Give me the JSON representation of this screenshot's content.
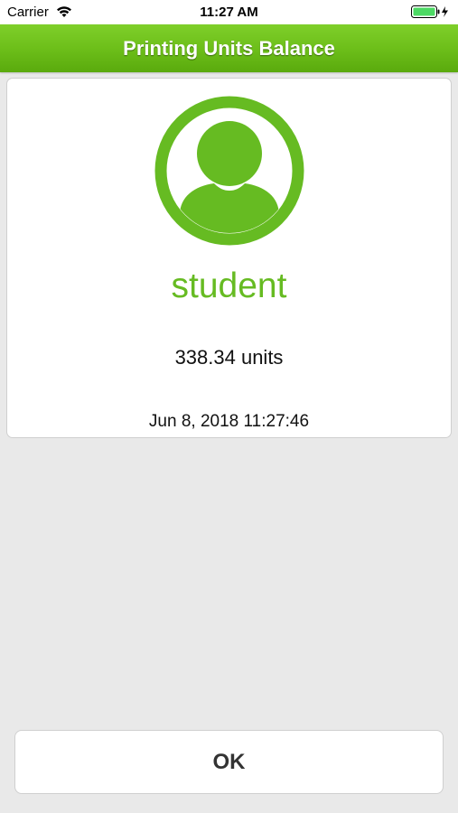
{
  "status_bar": {
    "carrier": "Carrier",
    "time": "11:27 AM",
    "wifi_icon": "wifi-icon",
    "battery_icon": "battery-charging-icon"
  },
  "nav": {
    "title": "Printing Units Balance"
  },
  "profile": {
    "avatar_icon": "user-avatar-icon",
    "name": "student",
    "balance": "338.34 units",
    "timestamp": "Jun 8, 2018 11:27:46"
  },
  "actions": {
    "ok_label": "OK"
  },
  "colors": {
    "accent_green": "#66bb22",
    "nav_green": "#6dbf1a",
    "battery_green": "#4cd964"
  }
}
